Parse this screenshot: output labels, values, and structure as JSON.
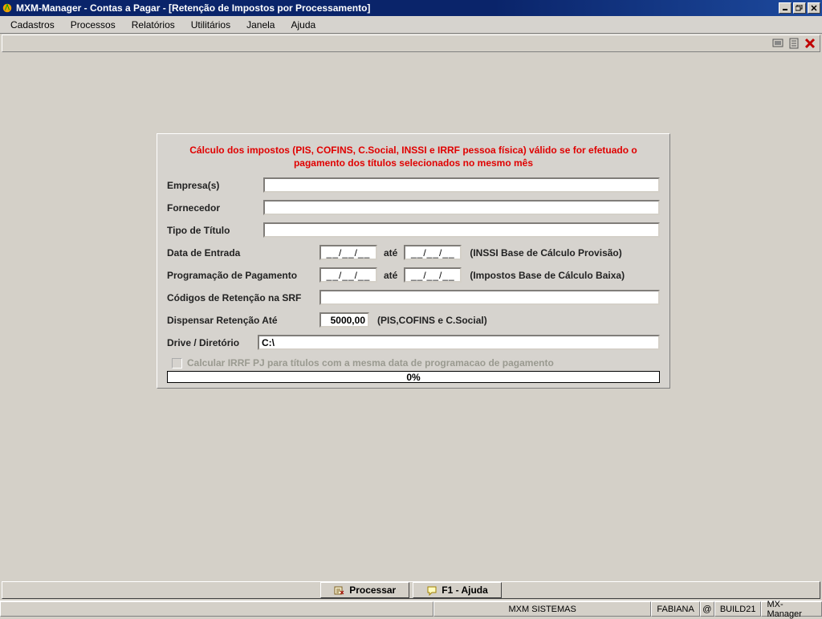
{
  "title": "MXM-Manager  -  Contas a Pagar - [Retenção de Impostos por Processamento]",
  "menu": [
    "Cadastros",
    "Processos",
    "Relatórios",
    "Utilitários",
    "Janela",
    "Ajuda"
  ],
  "warning_line1": "Cálculo dos impostos (PIS, COFINS, C.Social, INSSI e IRRF pessoa física) válido se for efetuado o",
  "warning_line2": "pagamento dos títulos selecionados no mesmo mês",
  "labels": {
    "empresa": "Empresa(s)",
    "fornecedor": "Fornecedor",
    "tipo": "Tipo de Título",
    "data_entrada": "Data de Entrada",
    "prog_pag": "Programação de Pagamento",
    "cod_ret": "Códigos de Retenção na SRF",
    "disp_ret": "Dispensar Retenção Até",
    "drive": "Drive / Diretório",
    "ate": "até"
  },
  "hints": {
    "data_entrada": "(INSSI Base de Cálculo Provisão)",
    "prog_pag": "(Impostos Base de Cálculo Baixa)",
    "disp_ret": "(PIS,COFINS e C.Social)"
  },
  "values": {
    "date_placeholder": "__/__/__",
    "disp_ret": "5000,00",
    "drive": "C:\\"
  },
  "checkbox_label": "Calcular IRRF PJ para títulos com a mesma data de programacao de pagamento",
  "progress": "0%",
  "buttons": {
    "processar": "Processar",
    "ajuda": "F1 - Ajuda"
  },
  "status": {
    "sistema": "MXM SISTEMAS",
    "user": "FABIANA",
    "at": "@",
    "build": "BUILD21",
    "app": "MX-Manager"
  }
}
